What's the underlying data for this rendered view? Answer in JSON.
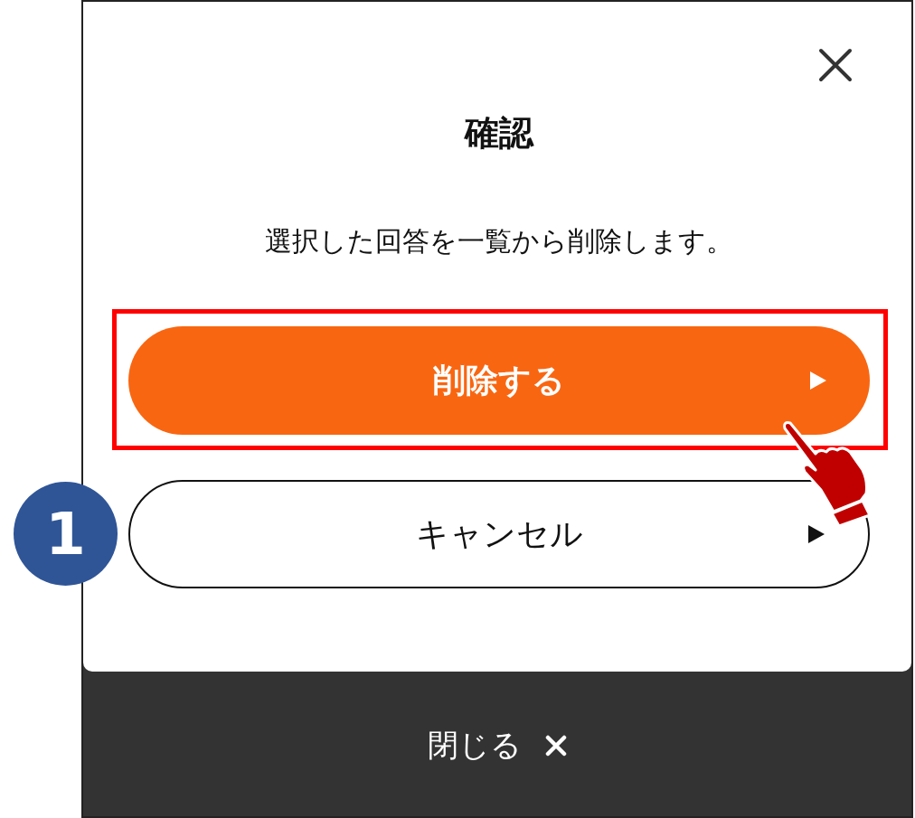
{
  "dialog": {
    "title": "確認",
    "message": "選択した回答を一覧から削除します。",
    "buttons": [
      {
        "label": "削除する",
        "kind": "primary",
        "highlighted": true
      },
      {
        "label": "キャンセル",
        "kind": "secondary",
        "highlighted": false
      }
    ],
    "footer": {
      "label": "閉じる"
    }
  },
  "step_badge": {
    "label": "1"
  }
}
